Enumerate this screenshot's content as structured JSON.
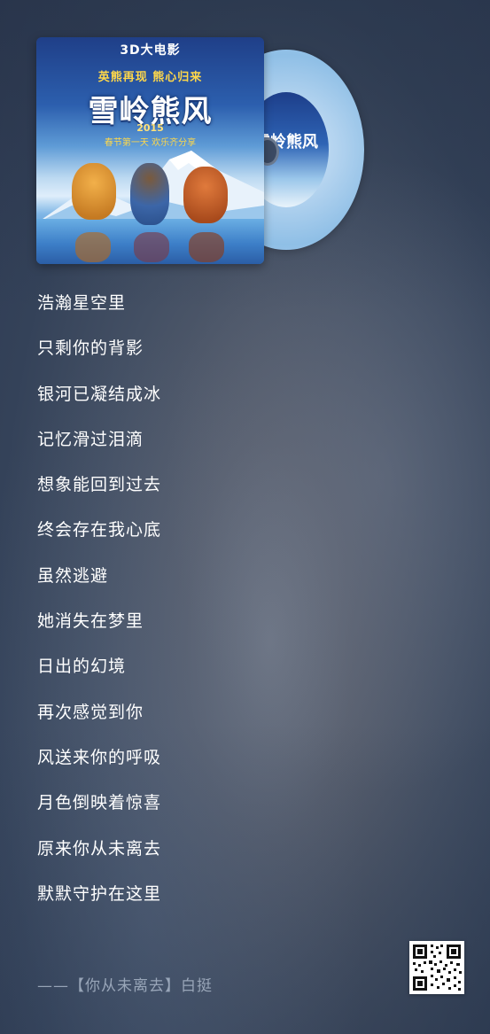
{
  "album": {
    "top_text": "3D大电影",
    "tagline": "英熊再现 熊心归来",
    "title": "雪岭熊风",
    "year": "2015",
    "subtitle": "春节第一天 欢乐齐分享"
  },
  "lyrics": [
    "浩瀚星空里",
    "只剩你的背影",
    "银河已凝结成冰",
    "记忆滑过泪滴",
    "想象能回到过去",
    "终会存在我心底",
    "虽然逃避",
    "她消失在梦里",
    "日出的幻境",
    "再次感觉到你",
    "风送来你的呼吸",
    "月色倒映着惊喜",
    "原来你从未离去",
    "默默守护在这里"
  ],
  "credit": "——【你从未离去】白挺",
  "icons": {
    "qr": "qr-code-icon",
    "disc": "vinyl-disc-icon"
  },
  "colors": {
    "lyric_text": "#ffffff",
    "credit_text": "#afbccd",
    "disc": "#b3d3ef"
  }
}
